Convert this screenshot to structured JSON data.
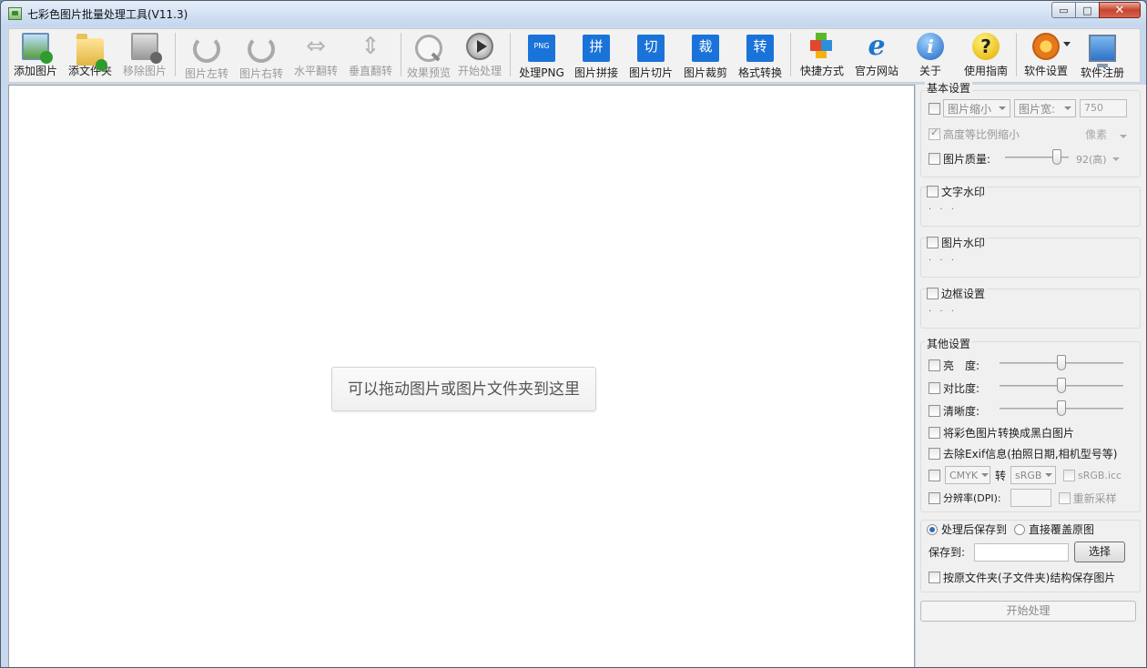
{
  "window": {
    "title": "七彩色图片批量处理工具(V11.3)",
    "controls": {
      "minimize": "▭",
      "maximize": "□",
      "close": "✕"
    }
  },
  "toolbar": {
    "add_image": "添加图片",
    "add_folder": "添文件夹",
    "remove_image": "移除图片",
    "rotate_left": "图片左转",
    "rotate_right": "图片右转",
    "flip_horizontal": "水平翻转",
    "flip_vertical": "垂直翻转",
    "preview": "效果预览",
    "start": "开始处理",
    "process_png": "处理PNG",
    "png_icon_text": "PNG",
    "stitch": "图片拼接",
    "stitch_icon_text": "拼",
    "slice": "图片切片",
    "slice_icon_text": "切",
    "crop": "图片裁剪",
    "crop_icon_text": "裁",
    "convert": "格式转换",
    "convert_icon_text": "转",
    "shortcut": "快捷方式",
    "website": "官方网站",
    "about": "关于",
    "help": "使用指南",
    "settings": "软件设置",
    "register": "软件注册"
  },
  "canvas": {
    "drop_hint": "可以拖动图片或图片文件夹到这里"
  },
  "panel": {
    "basic": {
      "title": "基本设置",
      "resize_mode": "图片缩小",
      "resize_by": "图片宽:",
      "resize_value": "750",
      "keep_ratio": "高度等比例缩小",
      "unit": "像素",
      "quality_label": "图片质量:",
      "quality_value": "92(高)"
    },
    "text_watermark": {
      "title": "文字水印",
      "dots": "· · ·"
    },
    "image_watermark": {
      "title": "图片水印",
      "dots": "· · ·"
    },
    "border": {
      "title": "边框设置",
      "dots": "· · ·"
    },
    "other": {
      "title": "其他设置",
      "brightness": "亮　度:",
      "contrast": "对比度:",
      "sharpness": "清晰度:",
      "grayscale": "将彩色图片转换成黑白图片",
      "remove_exif": "去除Exif信息(拍照日期,相机型号等)",
      "cmyk_from": "CMYK",
      "cmyk_to_label": "转",
      "cmyk_to": "sRGB",
      "srgb_icc": "sRGB.icc",
      "dpi_label": "分辨率(DPI):",
      "resample": "重新采样"
    },
    "save": {
      "save_to_option": "处理后保存到",
      "overwrite_option": "直接覆盖原图",
      "path_label": "保存到:",
      "path_value": "",
      "choose_button": "选择",
      "keep_structure": "按原文件夹(子文件夹)结构保存图片"
    },
    "start_button": "开始处理"
  }
}
